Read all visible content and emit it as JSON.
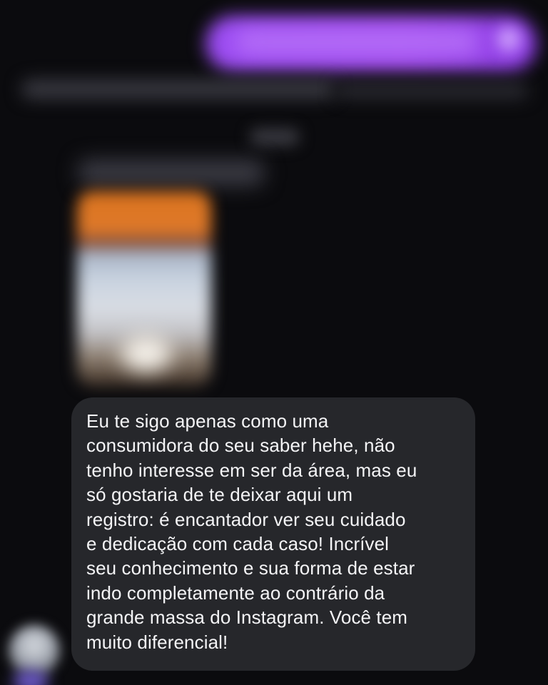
{
  "conversation": {
    "received_message": {
      "text": "Eu te sigo apenas como uma\nconsumidora do seu saber hehe, não\ntenho interesse em ser da área, mas eu\nsó gostaria de te deixar aqui um\nregistro: é encantador ver seu cuidado\ne dedicação com cada caso! Incrível\nseu conhecimento e sua forma de estar\nindo completamente ao contrário da\ngrande massa do Instagram. Você tem\nmuito diferencial!"
    }
  },
  "colors": {
    "background": "#0b0b0e",
    "received_bubble": "#26272b",
    "sent_bubble": "#9b4cf2",
    "message_text": "#f4f4f6"
  }
}
